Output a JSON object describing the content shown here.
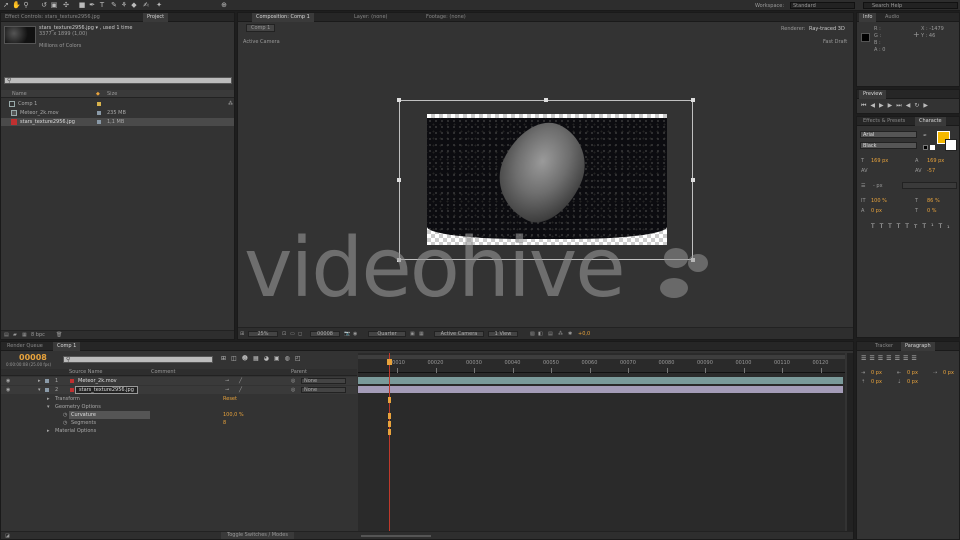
{
  "toolbar": {
    "workspace_label": "Workspace:",
    "workspace_value": "Standard",
    "search_placeholder": "Search Help"
  },
  "project_panel": {
    "tabs": [
      "Effect Controls: stars_texture2956.jpg",
      "Project"
    ],
    "asset_name": "stars_texture2956.jpg ▾ , used 1 time",
    "asset_dims": "3377 x 1899 (1,00)",
    "asset_colors": "Millions of Colors",
    "columns": {
      "name": "Name",
      "size": "Size"
    },
    "items": [
      {
        "name": "Comp 1",
        "size": ""
      },
      {
        "name": "Meteor_2k.mov",
        "size": "235 MB"
      },
      {
        "name": "stars_texture2956.jpg",
        "size": "1,1 MB"
      }
    ],
    "bpc": "8 bpc"
  },
  "comp_panel": {
    "tabs": [
      "Composition: Comp 1",
      "Layer: (none)",
      "Footage: (none)"
    ],
    "comp_tab": "Comp 1",
    "renderer_label": "Renderer:",
    "renderer_value": "Ray-traced 3D",
    "camera_label": "Active Camera",
    "draft_label": "Fast Draft",
    "zoom": "25%",
    "timecode": "00008",
    "resolution": "Quarter",
    "view_camera": "Active Camera",
    "view_count": "1 View",
    "exposure": "+0,0"
  },
  "watermark": "videohive",
  "info_panel": {
    "tabs": [
      "Info",
      "Audio"
    ],
    "r": "R :",
    "g": "G :",
    "b": "B :",
    "a": "A : 0",
    "x": "X : -1479",
    "y": "Y : 46"
  },
  "preview_panel": {
    "tab": "Preview"
  },
  "character_panel": {
    "tabs": [
      "Effects & Presets",
      "Characte"
    ],
    "font": "Arial",
    "style": "Black",
    "size": "169 px",
    "leading": "169 px",
    "tracking": "-57",
    "stroke": "- px",
    "vscale": "100 %",
    "hscale": "86 %",
    "baseline": "0 px",
    "tsume": "0 %"
  },
  "timeline": {
    "tabs": [
      "Render Queue",
      "Comp 1"
    ],
    "timecode": "00008",
    "timecode_sub": "0:00:00:08 (25.00 fps)",
    "columns": {
      "source": "Source Name",
      "comment": "Comment",
      "parent": "Parent"
    },
    "ruler": [
      "00010",
      "00020",
      "00030",
      "00040",
      "00050",
      "00060",
      "00070",
      "00080",
      "00090",
      "00100",
      "00110",
      "00120"
    ],
    "layers": [
      {
        "num": "1",
        "name": "Meteor_2k.mov",
        "parent": "None"
      },
      {
        "num": "2",
        "name": "stars_texture2956.jpg",
        "parent": "None"
      }
    ],
    "props": [
      {
        "name": "Transform",
        "value": "Reset"
      },
      {
        "name": "Geometry Options",
        "value": ""
      },
      {
        "name": "Curvature",
        "value": "100,0 %"
      },
      {
        "name": "Segments",
        "value": "8"
      },
      {
        "name": "Material Options",
        "value": ""
      }
    ],
    "toggle_label": "Toggle Switches / Modes"
  },
  "paragraph_panel": {
    "tabs": [
      "Tracker",
      "Paragraph"
    ],
    "indent1": "0 px",
    "indent2": "0 px",
    "indent3": "0 px",
    "space1": "0 px",
    "space2": "0 px"
  }
}
